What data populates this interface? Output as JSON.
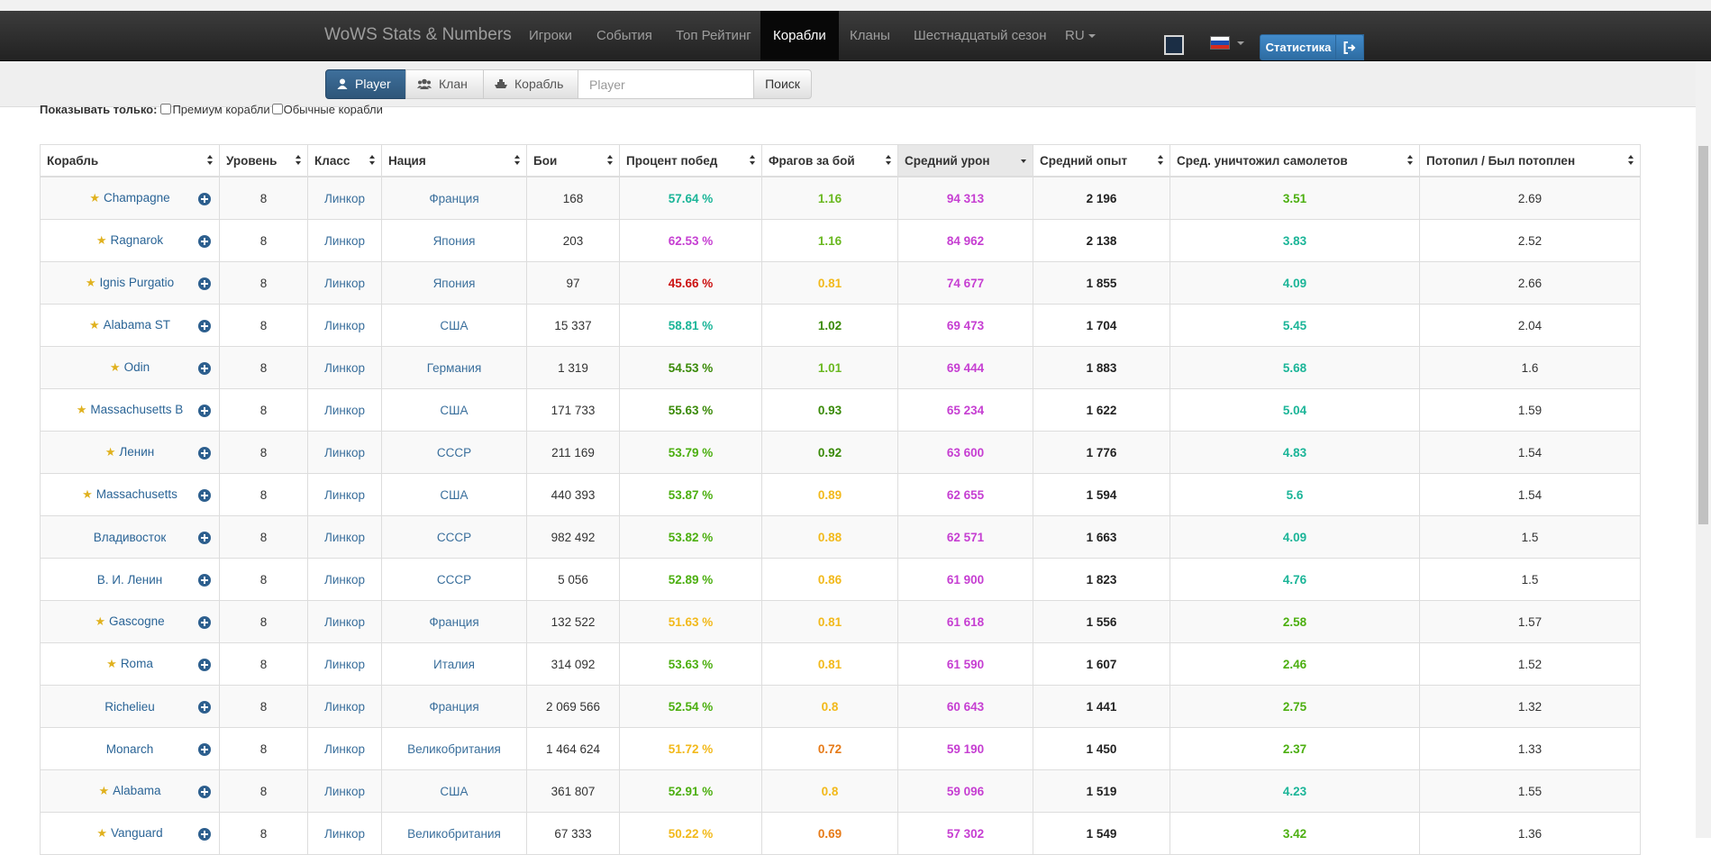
{
  "nav": {
    "brand": "WoWS Stats & Numbers",
    "links": [
      {
        "label": "Игроки"
      },
      {
        "label": "События"
      },
      {
        "label": "Топ Рейтинг"
      },
      {
        "label": "Корабли"
      },
      {
        "label": "Кланы"
      },
      {
        "label": "Шестнадцатый сезон"
      },
      {
        "label": "RU"
      }
    ],
    "active": "Корабли",
    "stats_label": "Статистика",
    "color_box": "#1b2e45"
  },
  "search": {
    "tabs": [
      {
        "label": "Player",
        "icon": "user-icon"
      },
      {
        "label": "Клан",
        "icon": "users-icon"
      },
      {
        "label": "Корабль",
        "icon": "ship-icon"
      }
    ],
    "placeholder": "Player",
    "button_label": "Поиск"
  },
  "filter": {
    "label": "Показывать только:",
    "premium_label": "Премиум корабли",
    "regular_label": "Обычные корабли"
  },
  "table": {
    "headers": [
      {
        "label": "Корабль"
      },
      {
        "label": "Уровень"
      },
      {
        "label": "Класс"
      },
      {
        "label": "Нация"
      },
      {
        "label": "Бои"
      },
      {
        "label": "Процент побед"
      },
      {
        "label": "Фрагов за бой"
      },
      {
        "label": "Средний урон"
      },
      {
        "label": "Средний опыт"
      },
      {
        "label": "Сред. уничтожил самолетов"
      },
      {
        "label": "Потопил / Был потоплен"
      }
    ],
    "sorted_column": "Средний урон",
    "rows": [
      {
        "ship": "Champagne",
        "premium": true,
        "tier": "8",
        "class": "Линкор",
        "nation": "Франция",
        "battles": "168",
        "winrate": "57.64 %",
        "winrate_color": "teal",
        "frags": "1.16",
        "frags_color": "lgreen",
        "damage": "94 313",
        "xp": "2 196",
        "planes": "3.51",
        "planes_color": "green",
        "kd": "2.69"
      },
      {
        "ship": "Ragnarok",
        "premium": true,
        "tier": "8",
        "class": "Линкор",
        "nation": "Япония",
        "battles": "203",
        "winrate": "62.53 %",
        "winrate_color": "purple",
        "frags": "1.16",
        "frags_color": "lgreen",
        "damage": "84 962",
        "xp": "2 138",
        "planes": "3.83",
        "planes_color": "teal",
        "kd": "2.52"
      },
      {
        "ship": "Ignis Purgatio",
        "premium": true,
        "tier": "8",
        "class": "Линкор",
        "nation": "Япония",
        "battles": "97",
        "winrate": "45.66 %",
        "winrate_color": "red",
        "frags": "0.81",
        "frags_color": "yellow",
        "damage": "74 677",
        "xp": "1 855",
        "planes": "4.09",
        "planes_color": "teal",
        "kd": "2.66"
      },
      {
        "ship": "Alabama ST",
        "premium": true,
        "tier": "8",
        "class": "Линкор",
        "nation": "США",
        "battles": "15 337",
        "winrate": "58.81 %",
        "winrate_color": "teal",
        "frags": "1.02",
        "frags_color": "dgreen",
        "damage": "69 473",
        "xp": "1 704",
        "planes": "5.45",
        "planes_color": "teal",
        "kd": "2.04"
      },
      {
        "ship": "Odin",
        "premium": true,
        "tier": "8",
        "class": "Линкор",
        "nation": "Германия",
        "battles": "1 319",
        "winrate": "54.53 %",
        "winrate_color": "dgreen",
        "frags": "1.01",
        "frags_color": "lgreen",
        "damage": "69 444",
        "xp": "1 883",
        "planes": "5.68",
        "planes_color": "teal",
        "kd": "1.6"
      },
      {
        "ship": "Massachusetts B",
        "premium": true,
        "tier": "8",
        "class": "Линкор",
        "nation": "США",
        "battles": "171 733",
        "winrate": "55.63 %",
        "winrate_color": "dgreen",
        "frags": "0.93",
        "frags_color": "dgreen",
        "damage": "65 234",
        "xp": "1 622",
        "planes": "5.04",
        "planes_color": "teal",
        "kd": "1.59"
      },
      {
        "ship": "Ленин",
        "premium": true,
        "tier": "8",
        "class": "Линкор",
        "nation": "СССР",
        "battles": "211 169",
        "winrate": "53.79 %",
        "winrate_color": "green",
        "frags": "0.92",
        "frags_color": "dgreen",
        "damage": "63 600",
        "xp": "1 776",
        "planes": "4.83",
        "planes_color": "teal",
        "kd": "1.54"
      },
      {
        "ship": "Massachusetts",
        "premium": true,
        "tier": "8",
        "class": "Линкор",
        "nation": "США",
        "battles": "440 393",
        "winrate": "53.87 %",
        "winrate_color": "green",
        "frags": "0.89",
        "frags_color": "yellow",
        "damage": "62 655",
        "xp": "1 594",
        "planes": "5.6",
        "planes_color": "teal",
        "kd": "1.54"
      },
      {
        "ship": "Владивосток",
        "premium": false,
        "tier": "8",
        "class": "Линкор",
        "nation": "СССР",
        "battles": "982 492",
        "winrate": "53.82 %",
        "winrate_color": "green",
        "frags": "0.88",
        "frags_color": "yellow",
        "damage": "62 571",
        "xp": "1 663",
        "planes": "4.09",
        "planes_color": "teal",
        "kd": "1.5"
      },
      {
        "ship": "В. И. Ленин",
        "premium": false,
        "tier": "8",
        "class": "Линкор",
        "nation": "СССР",
        "battles": "5 056",
        "winrate": "52.89 %",
        "winrate_color": "green",
        "frags": "0.86",
        "frags_color": "yellow",
        "damage": "61 900",
        "xp": "1 823",
        "planes": "4.76",
        "planes_color": "teal",
        "kd": "1.5"
      },
      {
        "ship": "Gascogne",
        "premium": true,
        "tier": "8",
        "class": "Линкор",
        "nation": "Франция",
        "battles": "132 522",
        "winrate": "51.63 %",
        "winrate_color": "yellow",
        "frags": "0.81",
        "frags_color": "yellow",
        "damage": "61 618",
        "xp": "1 556",
        "planes": "2.58",
        "planes_color": "green",
        "kd": "1.57"
      },
      {
        "ship": "Roma",
        "premium": true,
        "tier": "8",
        "class": "Линкор",
        "nation": "Италия",
        "battles": "314 092",
        "winrate": "53.63 %",
        "winrate_color": "green",
        "frags": "0.81",
        "frags_color": "yellow",
        "damage": "61 590",
        "xp": "1 607",
        "planes": "2.46",
        "planes_color": "green",
        "kd": "1.52"
      },
      {
        "ship": "Richelieu",
        "premium": false,
        "tier": "8",
        "class": "Линкор",
        "nation": "Франция",
        "battles": "2 069 566",
        "winrate": "52.54 %",
        "winrate_color": "green",
        "frags": "0.8",
        "frags_color": "yellow",
        "damage": "60 643",
        "xp": "1 441",
        "planes": "2.75",
        "planes_color": "green",
        "kd": "1.32"
      },
      {
        "ship": "Monarch",
        "premium": false,
        "tier": "8",
        "class": "Линкор",
        "nation": "Великобритания",
        "battles": "1 464 624",
        "winrate": "51.72 %",
        "winrate_color": "yellow",
        "frags": "0.72",
        "frags_color": "orange",
        "damage": "59 190",
        "xp": "1 450",
        "planes": "2.37",
        "planes_color": "green",
        "kd": "1.33"
      },
      {
        "ship": "Alabama",
        "premium": true,
        "tier": "8",
        "class": "Линкор",
        "nation": "США",
        "battles": "361 807",
        "winrate": "52.91 %",
        "winrate_color": "green",
        "frags": "0.8",
        "frags_color": "yellow",
        "damage": "59 096",
        "xp": "1 519",
        "planes": "4.23",
        "planes_color": "teal",
        "kd": "1.55"
      },
      {
        "ship": "Vanguard",
        "premium": true,
        "tier": "8",
        "class": "Линкор",
        "nation": "Великобритания",
        "battles": "67 333",
        "winrate": "50.22 %",
        "winrate_color": "yellow",
        "frags": "0.69",
        "frags_color": "orange",
        "damage": "57 302",
        "xp": "1 549",
        "planes": "3.42",
        "planes_color": "green",
        "kd": "1.36"
      }
    ]
  }
}
